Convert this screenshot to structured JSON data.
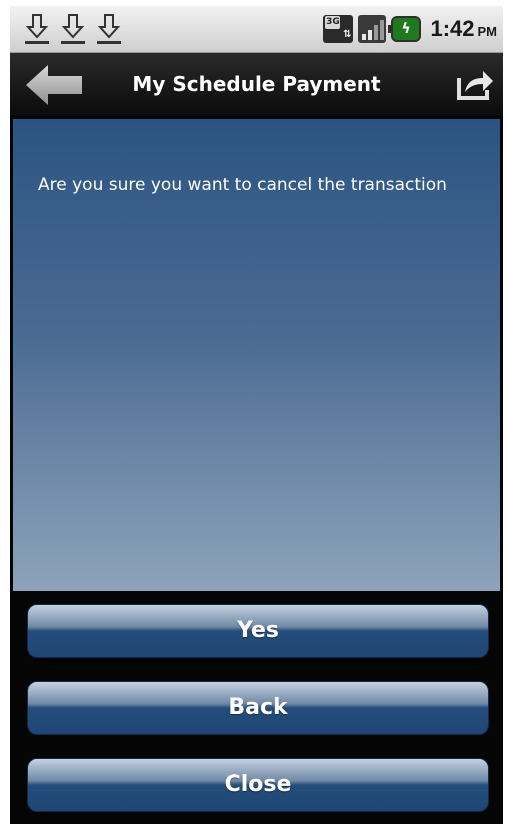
{
  "status_bar": {
    "icons": [
      "download-icon",
      "download-icon",
      "download-icon",
      "3g-network-icon",
      "signal-icon",
      "battery-charging-icon"
    ],
    "network_label": "3G",
    "time": "1:42",
    "ampm": "PM"
  },
  "header": {
    "title": "My Schedule Payment",
    "back_icon": "back-arrow-icon",
    "share_icon": "share-icon"
  },
  "main": {
    "message": "Are you sure you want to cancel the transaction"
  },
  "actions": {
    "yes_label": "Yes",
    "back_label": "Back",
    "close_label": "Close"
  },
  "colors": {
    "panel_top": "#2b5483",
    "panel_bottom": "#8ea3bb",
    "button_blue": "#244d7c",
    "title_bar": "#0b0b0b"
  }
}
